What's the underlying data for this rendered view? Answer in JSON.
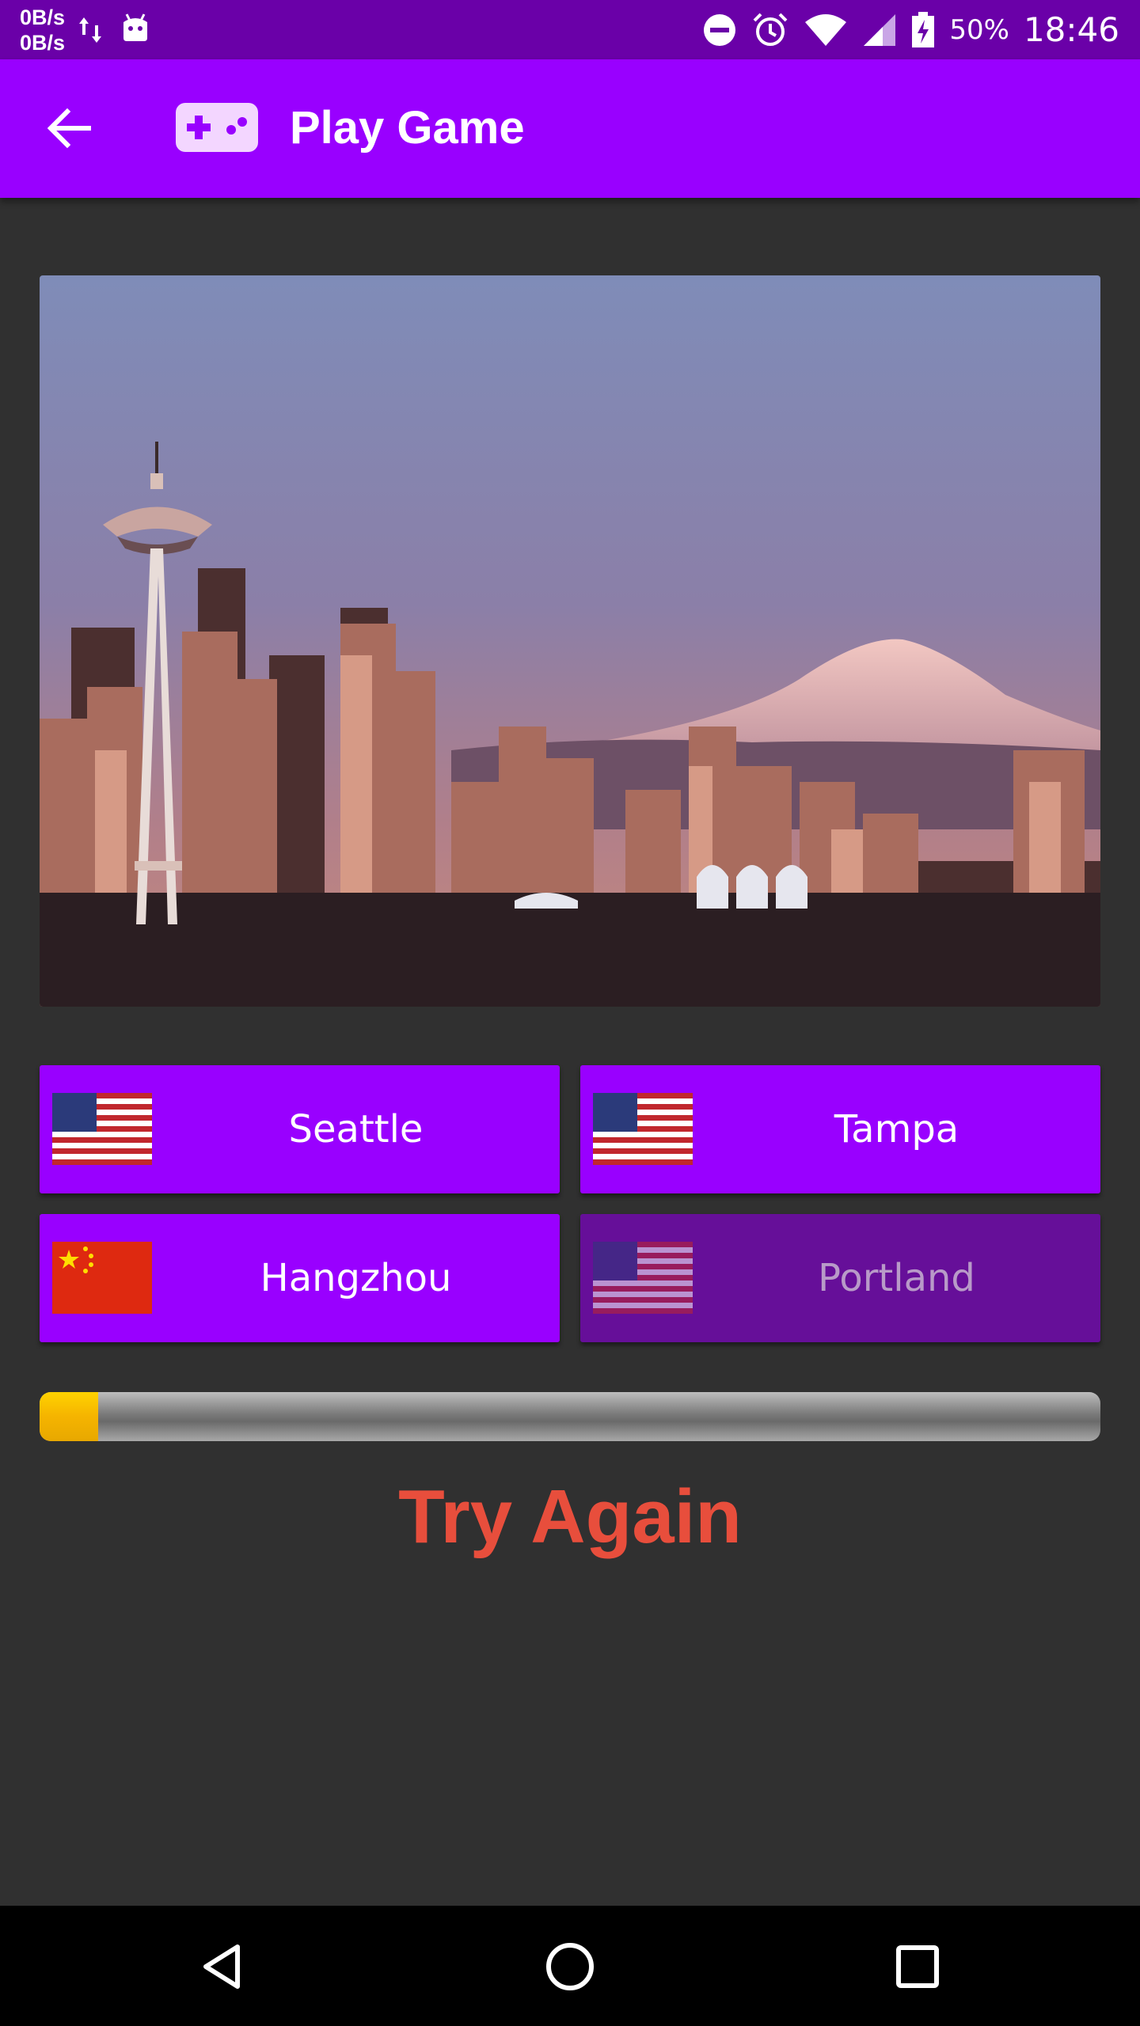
{
  "status_bar": {
    "net_up": "0B/s",
    "net_down": "0B/s",
    "battery": "50%",
    "time": "18:46",
    "icons": [
      "transfer-arrows-icon",
      "android-icon",
      "do-not-disturb-icon",
      "alarm-icon",
      "wifi-icon",
      "signal-icon",
      "battery-charging-icon"
    ]
  },
  "app_bar": {
    "title": "Play Game",
    "back_icon": "arrow-back-icon",
    "logo_icon": "gamepad-icon",
    "color": "#9900ff"
  },
  "question": {
    "image": "seattle-skyline-photo"
  },
  "answers": [
    {
      "label": "Seattle",
      "flag": "us-flag-icon",
      "enabled": true
    },
    {
      "label": "Tampa",
      "flag": "us-flag-icon",
      "enabled": true
    },
    {
      "label": "Hangzhou",
      "flag": "china-flag-icon",
      "enabled": true
    },
    {
      "label": "Portland",
      "flag": "us-flag-icon",
      "enabled": false
    }
  ],
  "progress": {
    "fraction": 0.055
  },
  "result": {
    "text": "Try Again",
    "color": "#e84e3c"
  },
  "nav_bar": {
    "icons": [
      "back-triangle-icon",
      "home-circle-icon",
      "recents-square-icon"
    ]
  }
}
